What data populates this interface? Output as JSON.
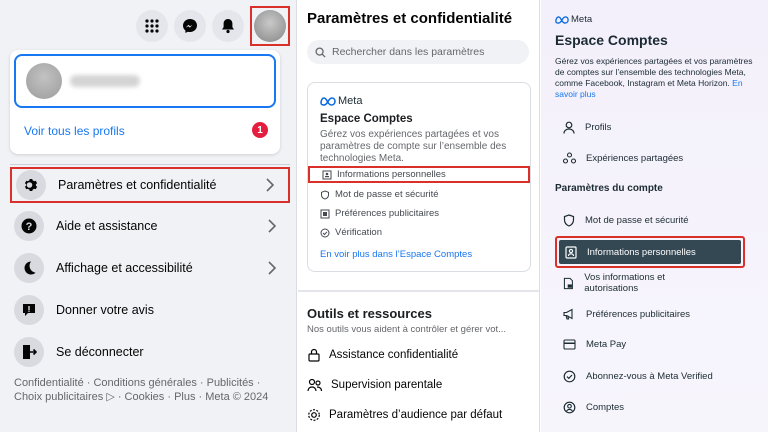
{
  "left": {
    "see_all_profiles": "Voir tous les profils",
    "notification_count": "1",
    "menu": [
      {
        "label": "Paramètres et confidentialité"
      },
      {
        "label": "Aide et assistance"
      },
      {
        "label": "Affichage et accessibilité"
      },
      {
        "label": "Donner votre avis"
      },
      {
        "label": "Se déconnecter"
      }
    ],
    "footer": "Confidentialité · Conditions générales · Publicités · Choix publicitaires ▷ · Cookies · Plus · Meta © 2024"
  },
  "middle": {
    "title": "Paramètres et confidentialité",
    "search_placeholder": "Rechercher dans les paramètres",
    "accounts_card": {
      "logo": "Meta",
      "title": "Espace Comptes",
      "description": "Gérez vos expériences partagées et vos paramètres de compte sur l’ensemble des technologies Meta.",
      "rows": [
        {
          "label": "Informations personnelles",
          "icon": "id-card-icon"
        },
        {
          "label": "Mot de passe et sécurité",
          "icon": "shield-icon"
        },
        {
          "label": "Préférences publicitaires",
          "icon": "ad-icon"
        },
        {
          "label": "Vérification",
          "icon": "check-circle-icon"
        }
      ],
      "link": "En voir plus dans l’Espace Comptes"
    },
    "tools": {
      "title": "Outils et ressources",
      "description": "Nos outils vous aident à contrôler et gérer vot...",
      "rows": [
        {
          "label": "Assistance confidentialité"
        },
        {
          "label": "Supervision parentale"
        },
        {
          "label": "Paramètres d’audience par défaut"
        }
      ]
    }
  },
  "right": {
    "logo": "Meta",
    "title": "Espace Comptes",
    "description": "Gérez vos expériences partagées et vos paramètres de comptes sur l’ensemble des technologies Meta, comme Facebook, Instagram et Meta Horizon.",
    "learn_more": "En savoir plus",
    "top_items": [
      {
        "label": "Profils"
      },
      {
        "label": "Expériences partagées"
      }
    ],
    "section_title": "Paramètres du compte",
    "account_items": [
      {
        "label": "Mot de passe et sécurité"
      },
      {
        "label": "Informations personnelles"
      },
      {
        "label": "Vos informations et autorisations"
      },
      {
        "label": "Préférences publicitaires"
      },
      {
        "label": "Meta Pay"
      },
      {
        "label": "Abonnez-vous à Meta Verified"
      },
      {
        "label": "Comptes"
      }
    ]
  },
  "colors": {
    "highlight_red": "#d9302a",
    "facebook_blue": "#1877f2",
    "active_item_bg": "#344854"
  }
}
